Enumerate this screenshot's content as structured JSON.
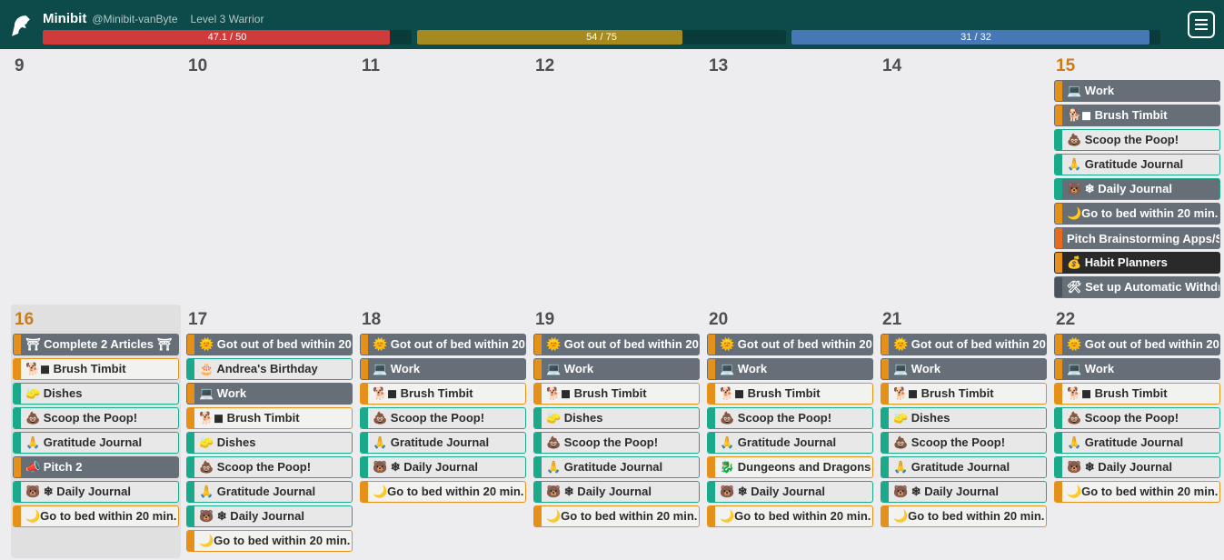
{
  "header": {
    "display_name": "Minibit",
    "username": "@Minibit-vanByte",
    "level": "Level 3 Warrior",
    "hp_text": "47.1 / 50",
    "hp_pct": 94,
    "xp_text": "54 / 75",
    "xp_pct": 72,
    "mp_text": "31 / 32",
    "mp_pct": 97
  },
  "week1": [
    {
      "num": "9",
      "hl": false,
      "tasks": []
    },
    {
      "num": "10",
      "hl": false,
      "tasks": []
    },
    {
      "num": "11",
      "hl": false,
      "tasks": []
    },
    {
      "num": "12",
      "hl": false,
      "tasks": []
    },
    {
      "num": "13",
      "hl": false,
      "tasks": []
    },
    {
      "num": "14",
      "hl": false,
      "tasks": []
    },
    {
      "num": "15",
      "hl": true,
      "tasks": [
        {
          "label": "💻 Work",
          "bg": "gray",
          "stripe": "orange"
        },
        {
          "label": "🐕◼ Brush Timbit",
          "bg": "gray",
          "stripe": "orange"
        },
        {
          "label": "💩 Scoop the Poop!",
          "bg": "light",
          "stripe": "teal",
          "border": "teal"
        },
        {
          "label": "🙏 Gratitude Journal",
          "bg": "light",
          "stripe": "teal",
          "border": "teal"
        },
        {
          "label": "🐻 ❄ Daily Journal",
          "bg": "gray",
          "stripe": "teal",
          "border": "teal"
        },
        {
          "label": "🌙Go to bed within 20 min. ...",
          "bg": "gray",
          "stripe": "orange"
        },
        {
          "label": "Pitch Brainstorming Apps/S...",
          "bg": "gray",
          "stripe": "orange2"
        },
        {
          "label": "💰 Habit Planners",
          "bg": "dark",
          "stripe": "orange"
        },
        {
          "label": "🛠 Set up Automatic Withdr...",
          "bg": "gray",
          "stripe": "gray"
        }
      ]
    }
  ],
  "week2": [
    {
      "num": "16",
      "hl": true,
      "today": true,
      "tasks": [
        {
          "label": "⛩ Complete 2 Articles ⛩",
          "bg": "gray",
          "stripe": "orange"
        },
        {
          "label": "🐕◼ Brush Timbit",
          "bg": "offwhite",
          "stripe": "orange",
          "border": "orange"
        },
        {
          "label": "🧽 Dishes",
          "bg": "light",
          "stripe": "teal",
          "border": "teal"
        },
        {
          "label": "💩 Scoop the Poop!",
          "bg": "light",
          "stripe": "teal",
          "border": "teal"
        },
        {
          "label": "🙏 Gratitude Journal",
          "bg": "light",
          "stripe": "teal",
          "border": "teal"
        },
        {
          "label": "📣 Pitch 2",
          "bg": "gray",
          "stripe": "orange"
        },
        {
          "label": "🐻 ❄ Daily Journal",
          "bg": "light",
          "stripe": "teal",
          "border": "teal"
        },
        {
          "label": "🌙Go to bed within 20 min. ...",
          "bg": "offwhite",
          "stripe": "orange",
          "border": "orange"
        }
      ]
    },
    {
      "num": "17",
      "hl": false,
      "tasks": [
        {
          "label": "🌞 Got out of bed within 20 ...",
          "bg": "gray",
          "stripe": "orange"
        },
        {
          "label": "🎂 Andrea's Birthday",
          "bg": "light",
          "stripe": "teal",
          "border": "teal"
        },
        {
          "label": "💻 Work",
          "bg": "gray",
          "stripe": "orange"
        },
        {
          "label": "🐕◼ Brush Timbit",
          "bg": "offwhite",
          "stripe": "orange",
          "border": "orange"
        },
        {
          "label": "🧽 Dishes",
          "bg": "light",
          "stripe": "teal",
          "border": "teal"
        },
        {
          "label": "💩 Scoop the Poop!",
          "bg": "light",
          "stripe": "teal",
          "border": "teal"
        },
        {
          "label": "🙏 Gratitude Journal",
          "bg": "light",
          "stripe": "teal",
          "border": "teal"
        },
        {
          "label": "🐻 ❄ Daily Journal",
          "bg": "light",
          "stripe": "teal",
          "border": "teal"
        },
        {
          "label": "🌙Go to bed within 20 min. ...",
          "bg": "offwhite",
          "stripe": "orange",
          "border": "orange"
        }
      ]
    },
    {
      "num": "18",
      "hl": false,
      "tasks": [
        {
          "label": "🌞 Got out of bed within 20 ...",
          "bg": "gray",
          "stripe": "orange"
        },
        {
          "label": "💻 Work",
          "bg": "gray",
          "stripe": "orange"
        },
        {
          "label": "🐕◼ Brush Timbit",
          "bg": "offwhite",
          "stripe": "orange",
          "border": "orange"
        },
        {
          "label": "💩 Scoop the Poop!",
          "bg": "light",
          "stripe": "teal",
          "border": "teal"
        },
        {
          "label": "🙏 Gratitude Journal",
          "bg": "light",
          "stripe": "teal",
          "border": "teal"
        },
        {
          "label": "🐻 ❄ Daily Journal",
          "bg": "light",
          "stripe": "teal",
          "border": "teal"
        },
        {
          "label": "🌙Go to bed within 20 min. ...",
          "bg": "offwhite",
          "stripe": "orange",
          "border": "orange"
        }
      ]
    },
    {
      "num": "19",
      "hl": false,
      "tasks": [
        {
          "label": "🌞 Got out of bed within 20 ...",
          "bg": "gray",
          "stripe": "orange"
        },
        {
          "label": "💻 Work",
          "bg": "gray",
          "stripe": "orange"
        },
        {
          "label": "🐕◼ Brush Timbit",
          "bg": "offwhite",
          "stripe": "orange",
          "border": "orange"
        },
        {
          "label": "🧽 Dishes",
          "bg": "light",
          "stripe": "teal",
          "border": "teal"
        },
        {
          "label": "💩 Scoop the Poop!",
          "bg": "light",
          "stripe": "teal",
          "border": "teal"
        },
        {
          "label": "🙏 Gratitude Journal",
          "bg": "light",
          "stripe": "teal",
          "border": "teal"
        },
        {
          "label": "🐻 ❄ Daily Journal",
          "bg": "light",
          "stripe": "teal",
          "border": "teal"
        },
        {
          "label": "🌙Go to bed within 20 min. ...",
          "bg": "offwhite",
          "stripe": "orange",
          "border": "orange"
        }
      ]
    },
    {
      "num": "20",
      "hl": false,
      "tasks": [
        {
          "label": "🌞 Got out of bed within 20 ...",
          "bg": "gray",
          "stripe": "orange"
        },
        {
          "label": "💻 Work",
          "bg": "gray",
          "stripe": "orange"
        },
        {
          "label": "🐕◼ Brush Timbit",
          "bg": "offwhite",
          "stripe": "orange",
          "border": "orange"
        },
        {
          "label": "💩 Scoop the Poop!",
          "bg": "light",
          "stripe": "teal",
          "border": "teal"
        },
        {
          "label": "🙏 Gratitude Journal",
          "bg": "light",
          "stripe": "teal",
          "border": "teal"
        },
        {
          "label": "🐉 Dungeons and Dragons ...",
          "bg": "offwhite",
          "stripe": "orange",
          "border": "orange"
        },
        {
          "label": "🐻 ❄ Daily Journal",
          "bg": "light",
          "stripe": "teal",
          "border": "teal"
        },
        {
          "label": "🌙Go to bed within 20 min. ...",
          "bg": "offwhite",
          "stripe": "orange",
          "border": "orange"
        }
      ]
    },
    {
      "num": "21",
      "hl": false,
      "tasks": [
        {
          "label": "🌞 Got out of bed within 20 ...",
          "bg": "gray",
          "stripe": "orange"
        },
        {
          "label": "💻 Work",
          "bg": "gray",
          "stripe": "orange"
        },
        {
          "label": "🐕◼ Brush Timbit",
          "bg": "offwhite",
          "stripe": "orange",
          "border": "orange"
        },
        {
          "label": "🧽 Dishes",
          "bg": "light",
          "stripe": "teal",
          "border": "teal"
        },
        {
          "label": "💩 Scoop the Poop!",
          "bg": "light",
          "stripe": "teal",
          "border": "teal"
        },
        {
          "label": "🙏 Gratitude Journal",
          "bg": "light",
          "stripe": "teal",
          "border": "teal"
        },
        {
          "label": "🐻 ❄ Daily Journal",
          "bg": "light",
          "stripe": "teal",
          "border": "teal"
        },
        {
          "label": "🌙Go to bed within 20 min. ...",
          "bg": "offwhite",
          "stripe": "orange",
          "border": "orange"
        }
      ]
    },
    {
      "num": "22",
      "hl": false,
      "tasks": [
        {
          "label": "🌞 Got out of bed within 20 ...",
          "bg": "gray",
          "stripe": "orange"
        },
        {
          "label": "💻 Work",
          "bg": "gray",
          "stripe": "orange"
        },
        {
          "label": "🐕◼ Brush Timbit",
          "bg": "offwhite",
          "stripe": "orange",
          "border": "orange"
        },
        {
          "label": "💩 Scoop the Poop!",
          "bg": "light",
          "stripe": "teal",
          "border": "teal"
        },
        {
          "label": "🙏 Gratitude Journal",
          "bg": "light",
          "stripe": "teal",
          "border": "teal"
        },
        {
          "label": "🐻 ❄ Daily Journal",
          "bg": "light",
          "stripe": "teal",
          "border": "teal"
        },
        {
          "label": "🌙Go to bed within 20 min. ...",
          "bg": "offwhite",
          "stripe": "orange",
          "border": "orange"
        }
      ]
    }
  ]
}
